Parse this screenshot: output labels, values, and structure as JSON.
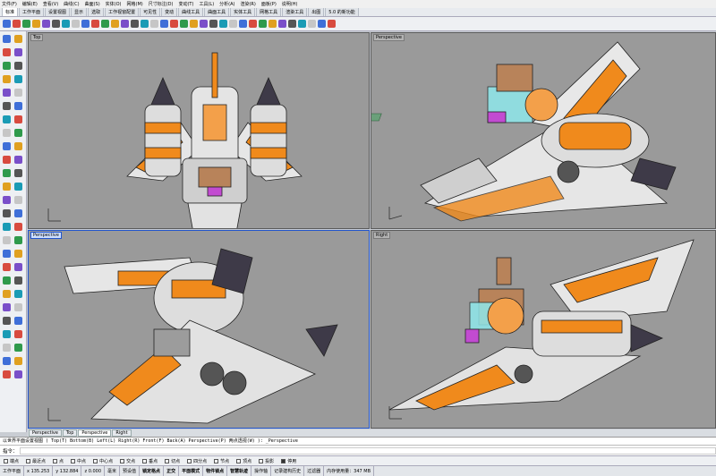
{
  "menu": [
    "文件(F)",
    "编辑(E)",
    "查看(V)",
    "曲线(C)",
    "曲面(S)",
    "实体(O)",
    "网格(M)",
    "尺寸标注(D)",
    "变动(T)",
    "工具(L)",
    "分析(A)",
    "渲染(R)",
    "面板(P)",
    "说明(H)"
  ],
  "toolbar_tabs": [
    "标准",
    "工作平面",
    "设置视图",
    "显示",
    "选取",
    "工作视窗配置",
    "可见性",
    "变动",
    "曲线工具",
    "曲面工具",
    "实体工具",
    "网格工具",
    "渲染工具",
    "出图",
    "5.0 的新功能"
  ],
  "viewports": {
    "top": "Top",
    "perspective_top": "Perspective",
    "perspective_bottom": "Perspective",
    "right": "Right"
  },
  "viewport_tabs": [
    "Perspective",
    "Top",
    "Perspective",
    "Right"
  ],
  "command_history": "以世界平面设置视图 ( Top(T) Bottom(B) Left(L) Right(R) Front(F) Back(A) Perspective(P) 两点透视(W) ): _Perspective",
  "command_prompt": "指令：",
  "osnaps": [
    {
      "label": "端点",
      "on": false
    },
    {
      "label": "最近点",
      "on": false
    },
    {
      "label": "点",
      "on": false
    },
    {
      "label": "中点",
      "on": false
    },
    {
      "label": "中心点",
      "on": false
    },
    {
      "label": "交点",
      "on": false
    },
    {
      "label": "垂点",
      "on": false
    },
    {
      "label": "切点",
      "on": false
    },
    {
      "label": "四分点",
      "on": false
    },
    {
      "label": "节点",
      "on": false
    },
    {
      "label": "顶点",
      "on": false
    },
    {
      "label": "投影",
      "on": false
    },
    {
      "label": "停用",
      "on": true
    }
  ],
  "status": {
    "cplane": "工作平面",
    "x": "x 135.253",
    "y": "y 132.884",
    "z": "z 0.000",
    "units": "毫米",
    "layer": "预设值",
    "grid_snap": "锁定格点",
    "ortho": "正交",
    "planar": "平面模式",
    "osnap": "物件锁点",
    "smarttrack": "智慧轨迹",
    "gumball": "操作轴",
    "record_history": "记录建构历史",
    "filter": "过滤器",
    "memory": "内存使用量：347 MB"
  }
}
